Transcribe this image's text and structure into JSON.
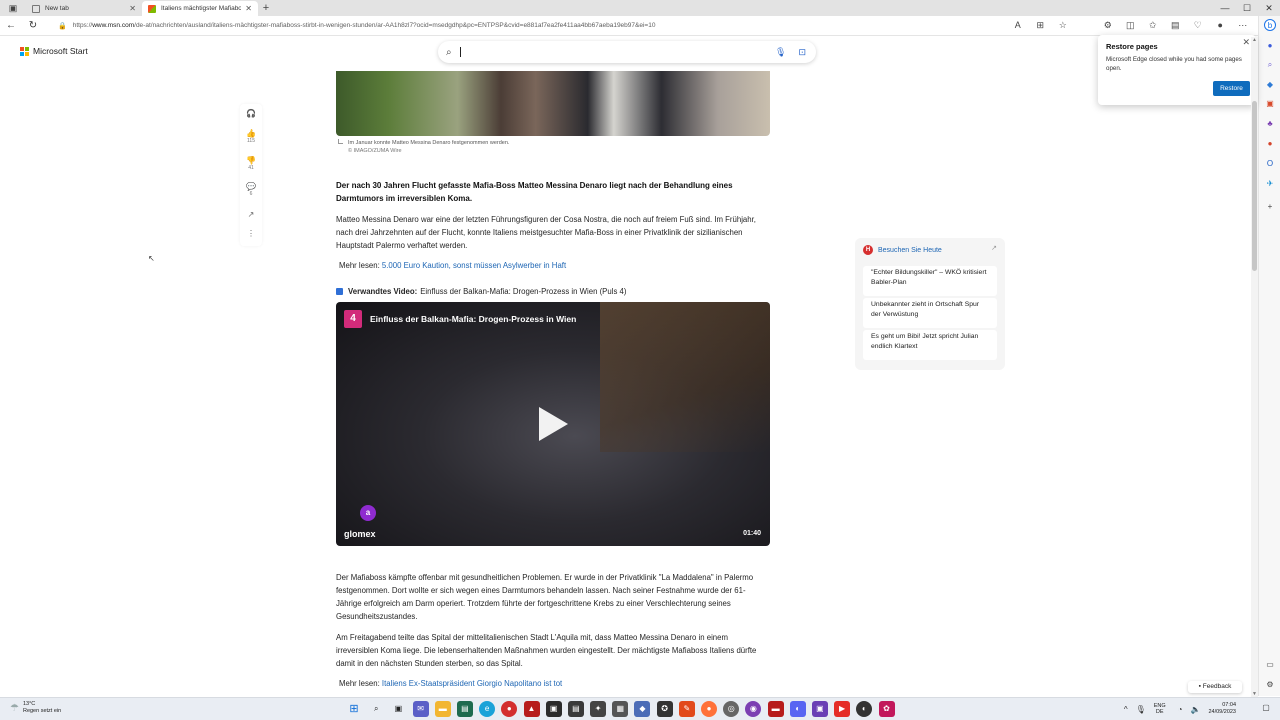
{
  "browser": {
    "tabs": [
      {
        "title": "New tab",
        "active": false
      },
      {
        "title": "Italiens mächtigster Mafiaboss st",
        "active": true
      }
    ],
    "url_prefix": "https://",
    "url_host": "www.msn.com",
    "url_path": "/de-at/nachrichten/ausland/italiens-mächtigster-mafiaboss-stirbt-in-wenigen-stunden/ar-AA1h8zl7?ocid=msedgdhp&pc=ENTPSP&cvid=e881af7ea2fe411aa4bb67aeba19eb97&ei=10"
  },
  "msn": {
    "logo_text": "Microsoft Start",
    "search_placeholder": ""
  },
  "article": {
    "caption": "Im Januar konnte Matteo Messina Denaro festgenommen werden.",
    "credit": "© IMAGO/ZUMA Wire",
    "lead": "Der nach 30 Jahren Flucht gefasste Mafia-Boss Matteo Messina Denaro liegt nach der Behandlung eines Darmtumors im irreversiblen Koma.",
    "p1": "Matteo Messina Denaro war eine der letzten Führungsfiguren der Cosa Nostra, die noch auf freiem Fuß sind. Im Frühjahr, nach drei Jahrzehnten auf der Flucht, konnte Italiens meistgesuchter Mafia-Boss in einer Privatklinik der sizilianischen Hauptstadt Palermo verhaftet werden.",
    "more1_label": "Mehr lesen:",
    "more1_link": "5.000 Euro Kaution, sonst müssen Asylwerber in Haft",
    "related_label": "Verwandtes Video:",
    "related_title": "Einfluss der Balkan-Mafia: Drogen-Prozess in Wien (Puls 4)",
    "p2": "Der Mafiaboss kämpfte offenbar mit gesundheitlichen Problemen. Er wurde in der Privatklinik \"La Maddalena\" in Palermo festgenommen. Dort wollte er sich wegen eines Darmtumors behandeln lassen. Nach seiner Festnahme wurde der 61-Jährige erfolgreich am Darm operiert. Trotzdem führte der fortgeschrittene Krebs zu einer Verschlechterung seines Gesundheitszustandes.",
    "p3": "Am Freitagabend teilte das Spital der mittelitalienischen Stadt L'Aquila mit, dass Matteo Messina Denaro in einem irreversiblen Koma liege. Die lebenserhaltenden Maßnahmen wurden eingestellt. Der mächtigste Mafiaboss Italiens dürfte damit in den nächsten Stunden sterben, so das Spital.",
    "more2_label": "Mehr lesen:",
    "more2_link": "Italiens Ex-Staatspräsident Giorgio Napolitano ist tot"
  },
  "video": {
    "channel_badge": "4",
    "title": "Einfluss der Balkan-Mafia: Drogen-Prozess in Wien",
    "provider_badge": "a",
    "brand": "glomex",
    "duration": "01:40"
  },
  "rail": {
    "likes": "115",
    "dislikes": "41",
    "comments": "6"
  },
  "widget": {
    "title": "Besuchen Sie Heute",
    "badge": "H",
    "items": [
      "\"Echter Bildungskiller\" – WKÖ kritisiert Babler-Plan",
      "Unbekannter zieht in Ortschaft Spur der Verwüstung",
      "Es geht um Bibi! Jetzt spricht Julian endlich Klartext"
    ]
  },
  "popup": {
    "title": "Restore pages",
    "body": "Microsoft Edge closed while you had some pages open.",
    "button": "Restore"
  },
  "feedback": "Feedback",
  "taskbar": {
    "temperature": "13°C",
    "weather": "Regen setzt ein",
    "lang_top": "ENG",
    "lang_bottom": "DE",
    "time": "07:04",
    "date": "24/09/2023"
  },
  "colors": {
    "accent": "#0f6cbd",
    "link": "#1e66b4",
    "video_badge": "#d22b7a",
    "widget_badge": "#d62f2f"
  }
}
